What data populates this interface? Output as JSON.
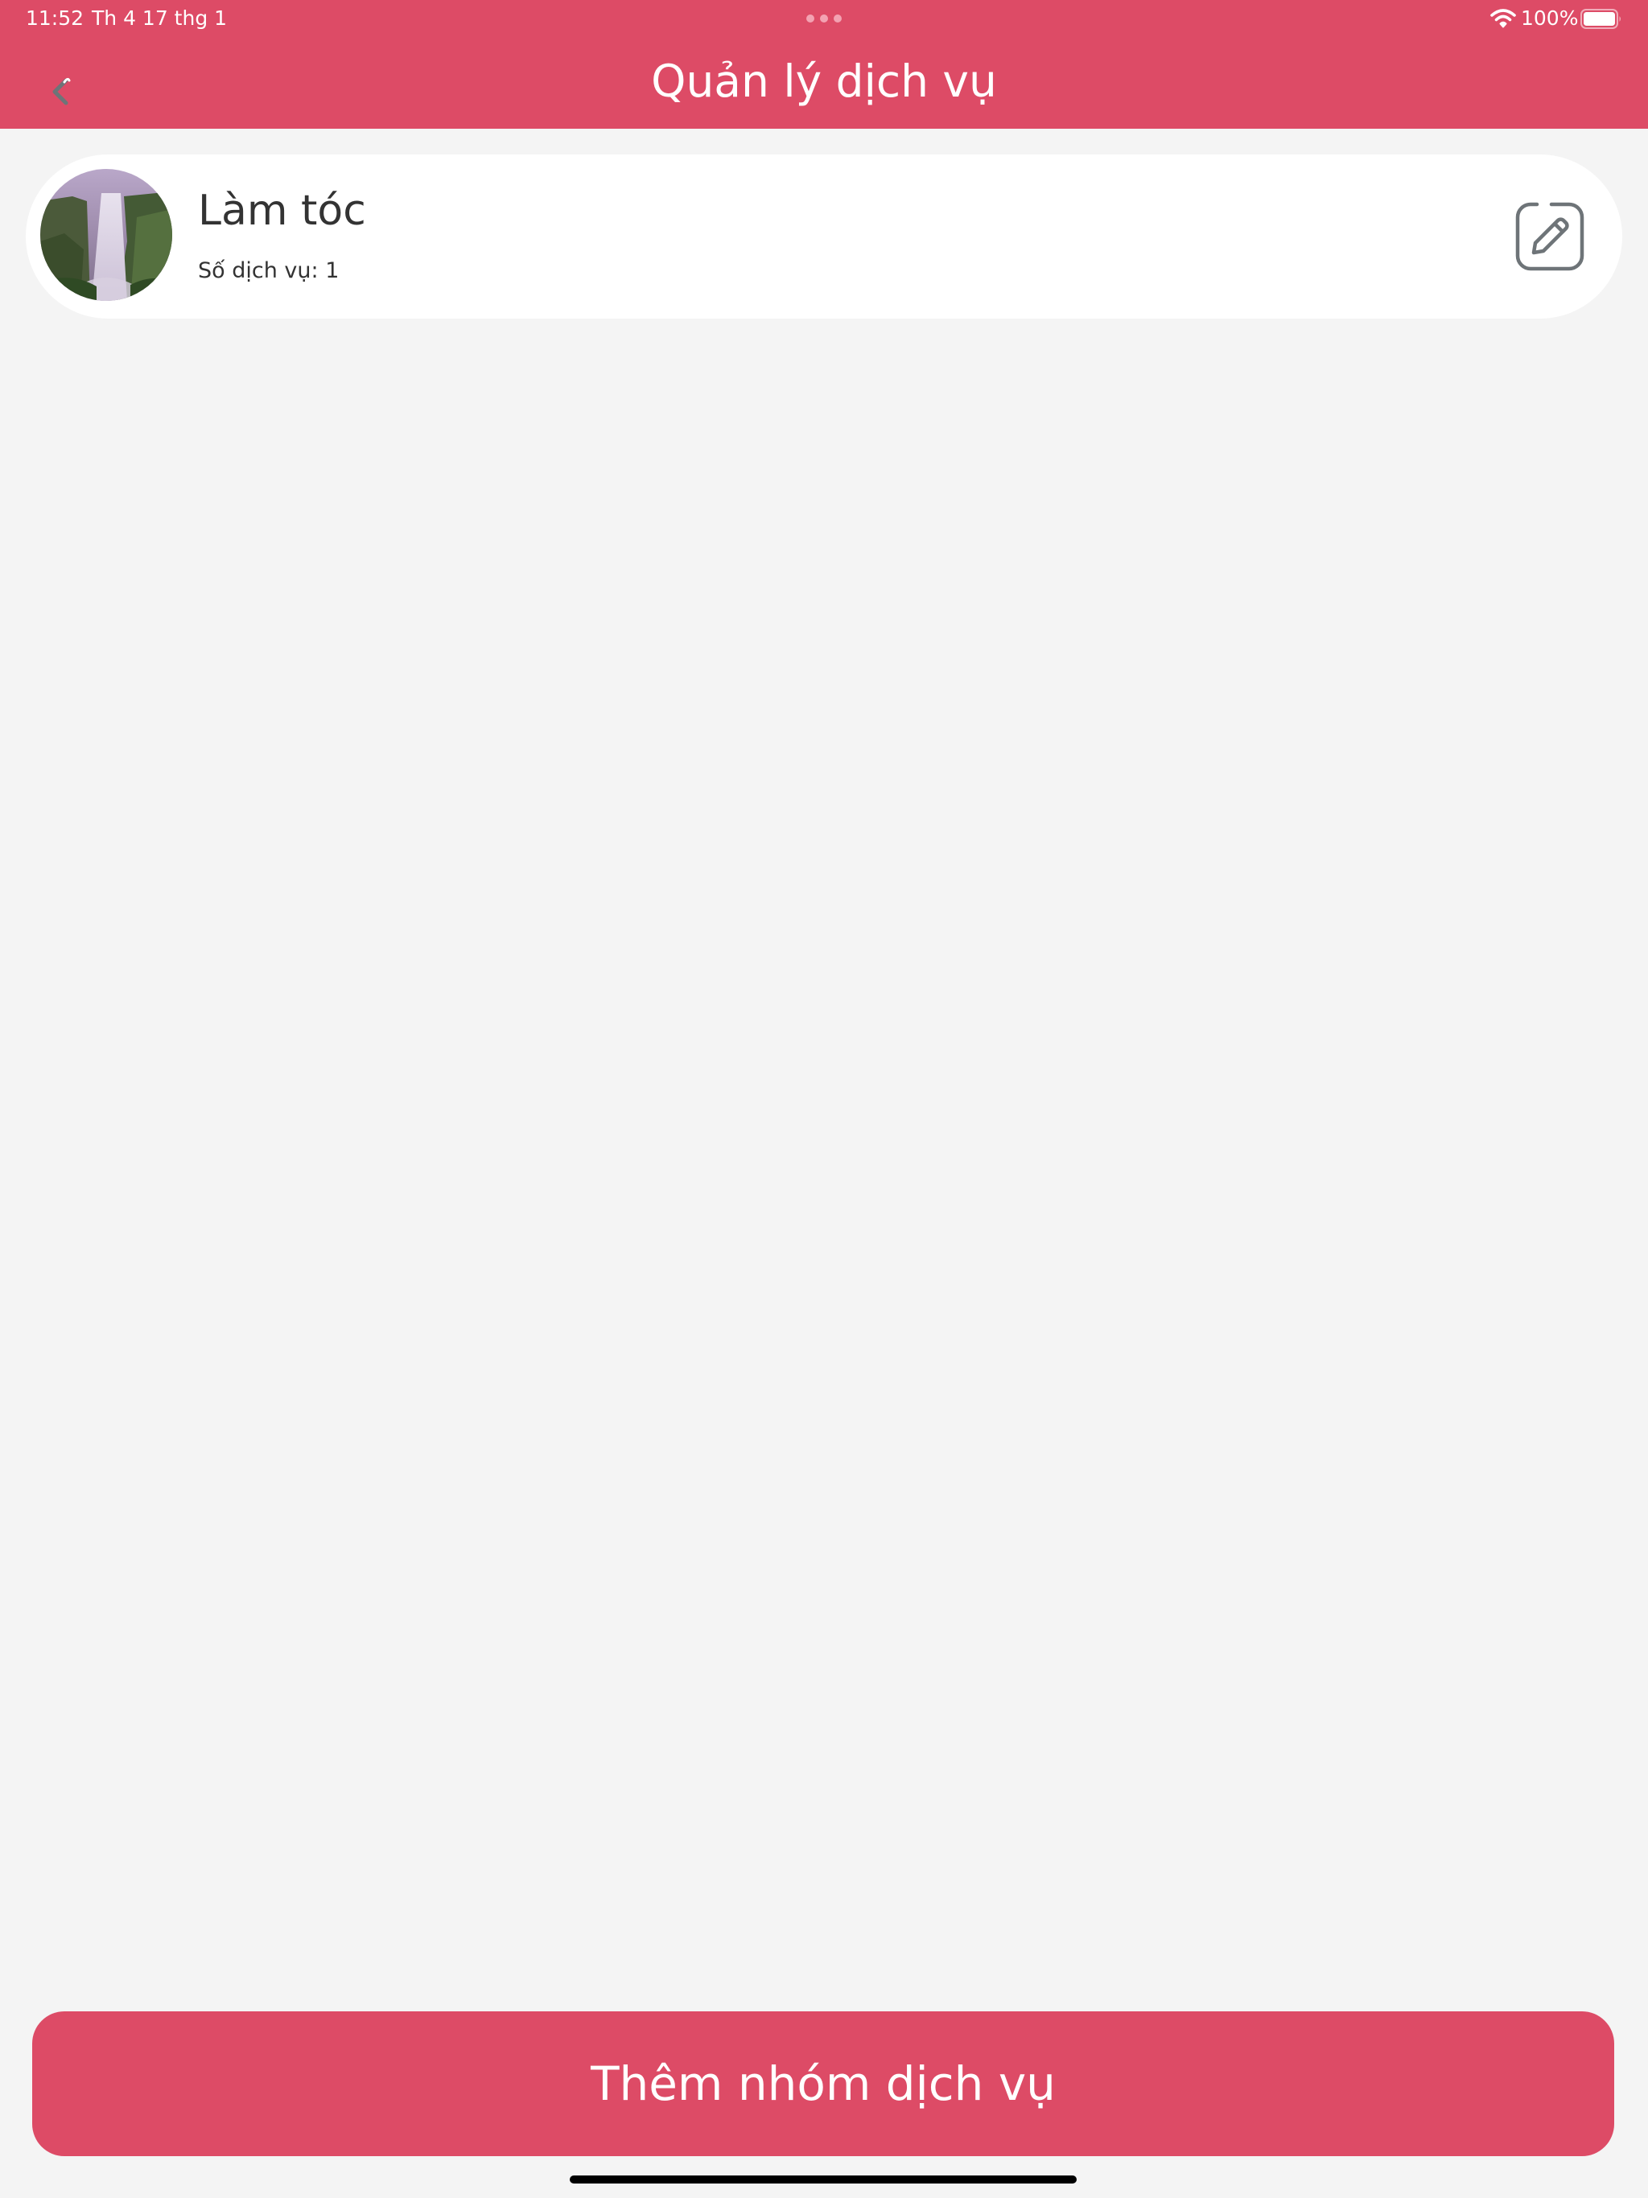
{
  "status_bar": {
    "time": "11:52",
    "date": "Th 4 17 thg 1",
    "battery": "100%"
  },
  "header": {
    "title": "Quản lý dịch vụ",
    "back_icon": "chevron-left-icon"
  },
  "groups": [
    {
      "name": "Làm tóc",
      "count_label": "Số dịch vụ: 1",
      "image": "waterfall-photo",
      "action_icon": "edit-square-icon"
    }
  ],
  "footer": {
    "add_button_label": "Thêm nhóm dịch vụ"
  },
  "colors": {
    "primary": "#dd4b66",
    "background": "#f4f4f4",
    "card": "#ffffff",
    "text": "#333333",
    "icon": "#6e7478"
  }
}
